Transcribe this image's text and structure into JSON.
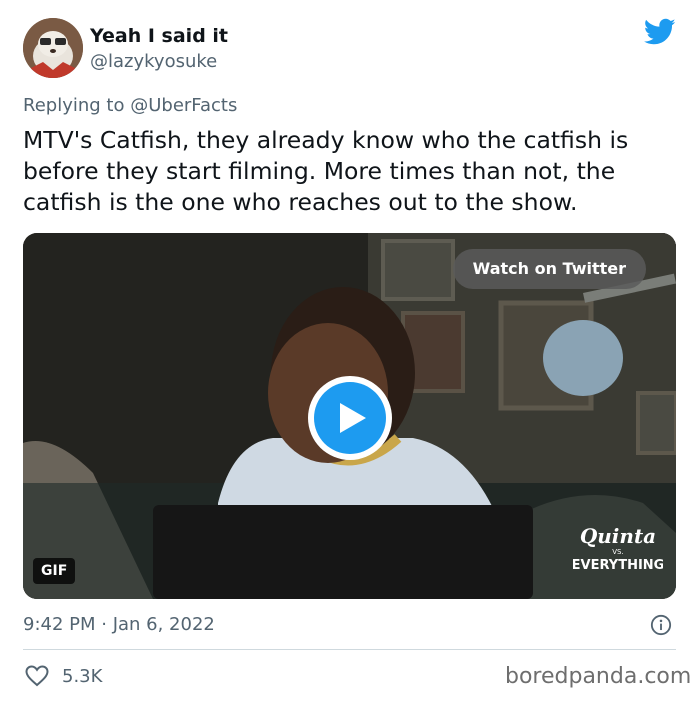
{
  "tweet": {
    "author": {
      "display_name": "Yeah I said it",
      "handle": "@lazykyosuke"
    },
    "replying_to": {
      "prefix": "Replying to",
      "mention": "@UberFacts"
    },
    "text": "MTV's Catfish, they already know who the catfish is before they start filming. More times than not, the catfish is the one who reaches out to the show.",
    "media": {
      "watch_label": "Watch on Twitter",
      "badge": "GIF",
      "watermark_line1": "Quinta",
      "watermark_line2": "VS.",
      "watermark_line3": "EVERYTHING"
    },
    "timestamp": "9:42 PM · Jan 6, 2022",
    "likes": "5.3K"
  },
  "site": {
    "watermark": "boredpanda.com"
  },
  "colors": {
    "twitter_blue": "#1d9bf0",
    "text": "#0f1419",
    "secondary_text": "#536471",
    "divider": "#cfd9de"
  },
  "icons": {
    "brand": "twitter-bird-icon",
    "play": "play-icon",
    "info": "info-icon",
    "like": "heart-icon"
  }
}
